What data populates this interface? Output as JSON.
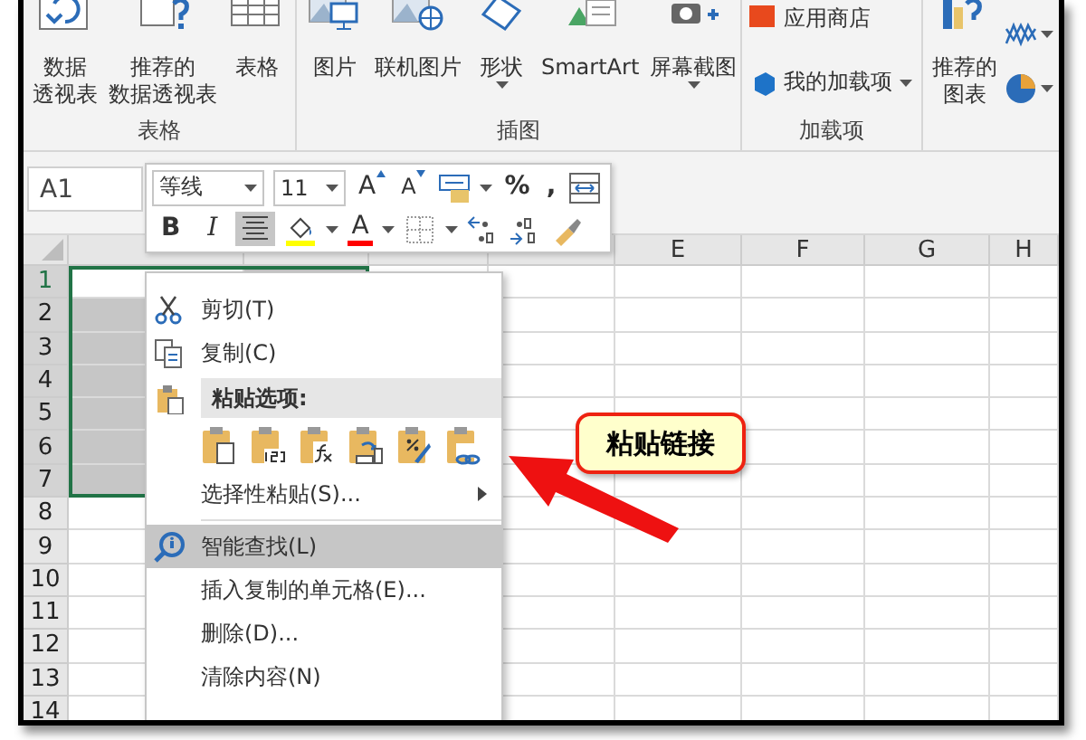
{
  "ribbon": {
    "groups": [
      {
        "label": "表格",
        "buttons": [
          {
            "kind": "large",
            "lines": [
              "数据",
              "透视表"
            ],
            "dropdown": false
          },
          {
            "kind": "large",
            "lines": [
              "推荐的",
              "数据透视表"
            ],
            "dropdown": false
          },
          {
            "kind": "large",
            "lines": [
              "表格"
            ],
            "dropdown": false
          }
        ]
      },
      {
        "label": "插图",
        "buttons": [
          {
            "kind": "large",
            "lines": [
              "图片"
            ],
            "dropdown": false
          },
          {
            "kind": "large",
            "lines": [
              "联机图片"
            ],
            "dropdown": false
          },
          {
            "kind": "large",
            "lines": [
              "形状"
            ],
            "dropdown": true
          },
          {
            "kind": "large",
            "lines": [
              "SmartArt"
            ],
            "dropdown": false
          },
          {
            "kind": "large",
            "lines": [
              "屏幕截图"
            ],
            "dropdown": true
          }
        ]
      },
      {
        "label": "加载项",
        "buttons": [
          {
            "kind": "small",
            "lines": [
              "应用商店"
            ],
            "dropdown": false
          },
          {
            "kind": "small",
            "lines": [
              "我的加载项"
            ],
            "dropdown": true
          }
        ]
      },
      {
        "buttons": [
          {
            "kind": "large",
            "lines": [
              "推荐的",
              "图表"
            ],
            "dropdown": false
          },
          {
            "kind": "icon",
            "dropdown": true
          },
          {
            "kind": "icon",
            "dropdown": true
          }
        ]
      }
    ]
  },
  "name_box": {
    "value": "A1"
  },
  "mini_toolbar": {
    "font": "等线",
    "size": "11",
    "row1": [
      {
        "kind": "grow",
        "text": "A"
      },
      {
        "kind": "shrink",
        "text": "A"
      },
      {
        "kind": "styles",
        "dropdown": true
      },
      {
        "kind": "text",
        "text": "%"
      },
      {
        "kind": "text",
        "text": ","
      },
      {
        "kind": "merge"
      }
    ],
    "row2": [
      {
        "kind": "bold",
        "text": "B",
        "selected": false
      },
      {
        "kind": "italic",
        "text": "I",
        "selected": false
      },
      {
        "kind": "align",
        "selected": true
      },
      {
        "kind": "fill",
        "dropdown": true
      },
      {
        "kind": "fontcolor",
        "text": "A",
        "dropdown": true
      },
      {
        "kind": "border",
        "dropdown": true
      },
      {
        "kind": "incdec"
      },
      {
        "kind": "decdec"
      },
      {
        "kind": "painter"
      }
    ]
  },
  "sheet": {
    "columns": [
      "E",
      "F",
      "G",
      "H"
    ],
    "rows": [
      {
        "number": "1",
        "selected": true,
        "active": true
      },
      {
        "number": "2",
        "selected": true,
        "active": false
      },
      {
        "number": "3",
        "selected": true,
        "active": false
      },
      {
        "number": "4",
        "selected": true,
        "active": false
      },
      {
        "number": "5",
        "selected": true,
        "active": false
      },
      {
        "number": "6",
        "selected": true,
        "active": false
      },
      {
        "number": "7",
        "selected": true,
        "active": false
      },
      {
        "number": "8",
        "selected": false,
        "active": false
      },
      {
        "number": "9",
        "selected": false,
        "active": false
      },
      {
        "number": "10",
        "selected": false,
        "active": false
      },
      {
        "number": "11",
        "selected": false,
        "active": false
      },
      {
        "number": "12",
        "selected": false,
        "active": false
      },
      {
        "number": "13",
        "selected": false,
        "active": false
      },
      {
        "number": "14",
        "selected": false,
        "active": false
      }
    ]
  },
  "context_menu": {
    "items": [
      {
        "kind": "item",
        "label": "剪切(T)",
        "selected": false,
        "disabled": false,
        "submenu": false
      },
      {
        "kind": "item",
        "label": "复制(C)",
        "selected": false,
        "disabled": false,
        "submenu": false
      },
      {
        "kind": "header",
        "label": "粘贴选项:"
      },
      {
        "kind": "paste-options"
      },
      {
        "kind": "item",
        "label": "选择性粘贴(S)...",
        "selected": false,
        "disabled": false,
        "submenu": true
      },
      {
        "kind": "separator"
      },
      {
        "kind": "item",
        "label": "智能查找(L)",
        "selected": true,
        "disabled": false,
        "submenu": false
      },
      {
        "kind": "item",
        "label": "插入复制的单元格(E)...",
        "selected": false,
        "disabled": false,
        "submenu": false
      },
      {
        "kind": "item",
        "label": "删除(D)...",
        "selected": false,
        "disabled": false,
        "submenu": false
      },
      {
        "kind": "item",
        "label": "清除内容(N)",
        "selected": false,
        "disabled": false,
        "submenu": false
      }
    ]
  },
  "callout": {
    "text": "粘贴链接"
  }
}
